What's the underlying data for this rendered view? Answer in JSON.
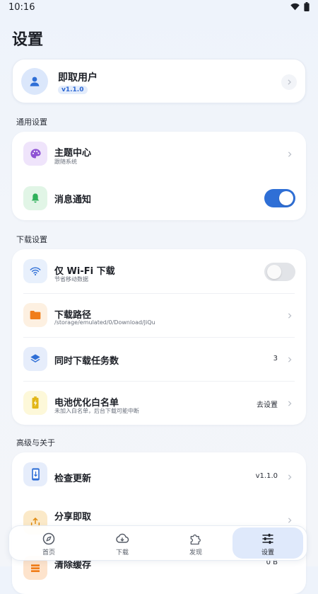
{
  "status_bar": {
    "time": "10:16"
  },
  "page": {
    "title": "设置"
  },
  "profile": {
    "name": "即取用户",
    "version": "v1.1.0"
  },
  "sections": {
    "general": {
      "label": "通用设置",
      "theme": {
        "title": "主题中心",
        "subtitle": "跟随系统"
      },
      "notifications": {
        "title": "消息通知",
        "enabled": true
      }
    },
    "download": {
      "label": "下载设置",
      "wifi_only": {
        "title": "仅 Wi-Fi 下载",
        "subtitle": "节省移动数据",
        "enabled": false
      },
      "path": {
        "title": "下载路径",
        "subtitle": "/storage/emulated/0/Download/JiQu"
      },
      "concurrent": {
        "title": "同时下载任务数",
        "value": "3"
      },
      "battery": {
        "title": "电池优化白名单",
        "subtitle": "未加入白名单，后台下载可能中断",
        "value": "去设置"
      }
    },
    "advanced": {
      "label": "高级与关于",
      "update": {
        "title": "检查更新",
        "value": "v1.1.0"
      },
      "share": {
        "title": "分享即取"
      },
      "cache": {
        "title": "清除缓存",
        "value": "0 B"
      }
    }
  },
  "nav": {
    "home": "首页",
    "download": "下载",
    "discover": "发现",
    "settings": "设置",
    "active": "settings"
  },
  "colors": {
    "accent": "#2f6fd6",
    "theme_icon_bg": "#efe4fb",
    "bell_icon_bg": "#e1f5e6",
    "wifi_icon_bg": "#e8f0fc",
    "folder_icon_bg": "#fdf0e1",
    "layers_icon_bg": "#e6edfb",
    "battery_icon_bg": "#fdf8d9",
    "update_icon_bg": "#e6edfb",
    "share_icon_bg": "#fbe9c8"
  }
}
